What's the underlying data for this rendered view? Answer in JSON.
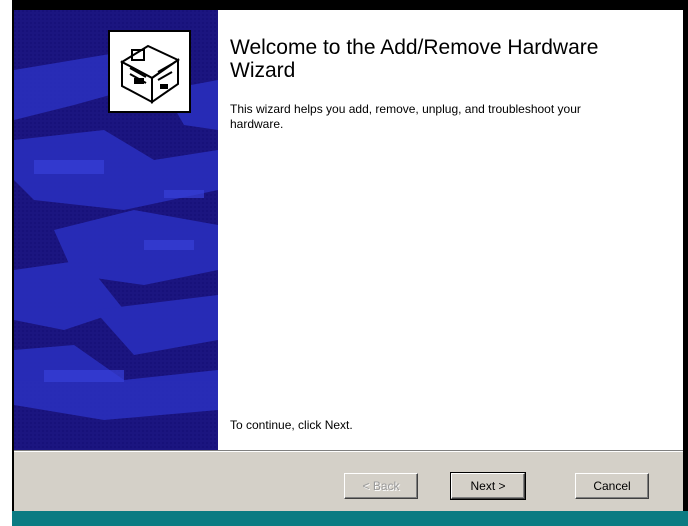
{
  "wizard": {
    "title": "Welcome to the Add/Remove Hardware Wizard",
    "intro": "This wizard helps you add, remove, unplug, and troubleshoot your hardware.",
    "continue_hint": "To continue, click Next.",
    "icon": "hardware-box-icon"
  },
  "buttons": {
    "back_label": "< Back",
    "next_label": "Next >",
    "cancel_label": "Cancel",
    "back_enabled": false
  },
  "colors": {
    "side_panel": "#1b1580",
    "button_face": "#d4d0c8",
    "desktop": "#0a7b82"
  }
}
